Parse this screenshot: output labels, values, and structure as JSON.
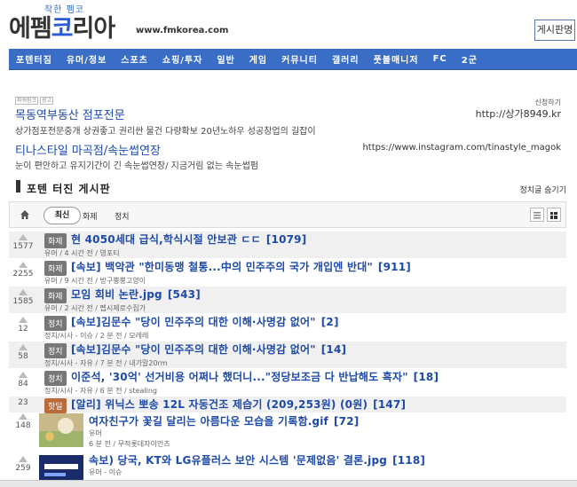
{
  "header": {
    "logo_sub": "착한 펨코",
    "logo_part1": "에펨",
    "logo_part2": "코",
    "logo_part3": "리아",
    "url": "www.fmkorea.com",
    "board_button": "게시판명"
  },
  "nav": [
    "포텐터짐",
    "유머/정보",
    "스포츠",
    "쇼핑/투자",
    "일반",
    "게임",
    "커뮤니티",
    "갤러리",
    "풋볼매니저",
    "FC",
    "2군"
  ],
  "ads": {
    "tag_prefix": "파워링크",
    "tag_label": "광고",
    "right_top": "신청하기",
    "items": [
      {
        "title": "목동역부동산 점포전문",
        "url": "http://상가8949.kr",
        "desc": "상가점포전문중개 상권좋고 권리싼 물건 다량확보 20년노하우 성공창업의 길잡이"
      },
      {
        "title": "티나스타일 마곡점/속눈썹연장",
        "url": "https://www.instagram.com/tinastyle_magok",
        "desc": "눈이 편안하고 유지기간이 긴 속눈썹연장/ 지금거림 없는 속눈썹펌"
      }
    ]
  },
  "board": {
    "title": "포텐 터진 게시판",
    "hide_notice": "정치글 숨기기",
    "tabs": {
      "latest": "최신",
      "topic": "화제",
      "politics": "정치"
    }
  },
  "posts": [
    {
      "votes": "1577",
      "cat": "화제",
      "title": "현 4050세대 급식,학식시절 안보관 ㄷㄷ",
      "comments": "[1079]",
      "meta": "유머 / 4 시간 전 / 영포티"
    },
    {
      "votes": "2255",
      "cat": "화제",
      "title": "[속보] 백악관 \"한미동맹 철통...中의 민주주의 국가 개입엔 반대\"",
      "comments": "[911]",
      "meta": "유머 / 9 시간 전 / 방구뿡뿡고양이"
    },
    {
      "votes": "1585",
      "cat": "화제",
      "title": "모임 회비 논란.jpg",
      "comments": "[543]",
      "meta": "유머 / 2 시간 전 / 펩시제로수집가"
    },
    {
      "votes": "12",
      "cat": "정치",
      "title": "[속보]김문수 \"당이 민주주의 대한 이해·사명감 없어\"",
      "comments": "[2]",
      "meta": "정치/시사 - 이슈 / 2 분 전 / 모레레"
    },
    {
      "votes": "58",
      "cat": "정치",
      "title": "[속보]김문수 \"당이 민주주의 대한 이해·사명감 없어\"",
      "comments": "[14]",
      "meta": "정치/시사 - 자유 / 7 분 전 / 내가말20rm"
    },
    {
      "votes": "84",
      "cat": "정치",
      "title": "이준석, '30억' 선거비용 어쩌나 했더니...\"정당보조금 다 반납해도 흑자\"",
      "comments": "[18]",
      "meta": "정치/시사 - 자유 / 6 분 전 / stealing"
    },
    {
      "votes": "23",
      "cat": "핫딜",
      "title": "[알리] 위닉스 뽀송 12L 자동건조 제습기 (209,253원) (0원)",
      "comments": "[147]",
      "meta": ""
    },
    {
      "votes": "148",
      "cat": "",
      "title": "여자친구가 꽃길 달리는 아름다운 모습을 기록함.gif",
      "comments": "[72]",
      "meta": "유머",
      "meta2": "6 분 전 / 무적롯데자이언츠"
    },
    {
      "votes": "259",
      "cat": "",
      "title": "속보) 당국, KT와 LG유플러스 보안 시스템 '문제없음' 결론.jpg",
      "comments": "[118]",
      "meta": "유머 - 이슈"
    }
  ],
  "colors": {
    "nav": "#3a6dc5",
    "link": "#1d4aa8",
    "hot_badge": "#b96b3c",
    "badge": "#777777"
  }
}
